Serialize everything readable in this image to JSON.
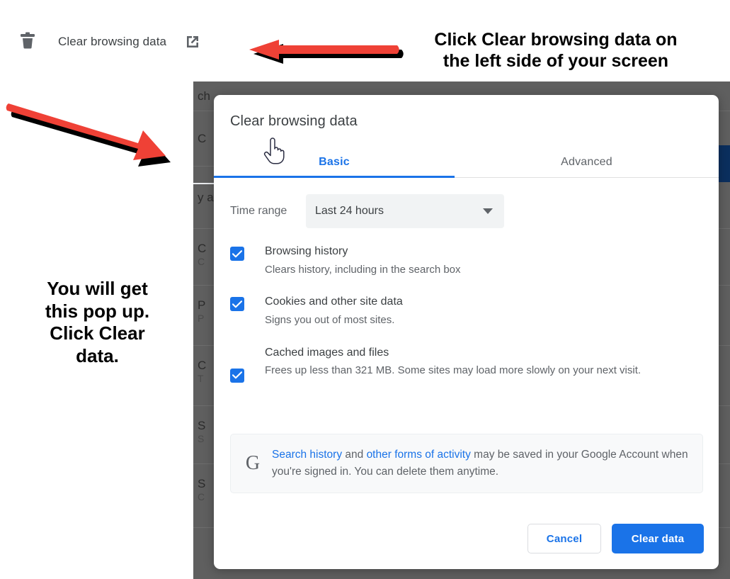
{
  "topbar": {
    "trash_icon": "trash-icon",
    "label": "Clear browsing data",
    "external_icon": "open-in-new-icon"
  },
  "annotations": {
    "top": "Click Clear browsing data on the left side of your screen",
    "top_line1": "Click Clear browsing data on",
    "top_line2": "the left side of your screen",
    "left_line1": "You will get",
    "left_line2": "this pop up.",
    "left_line3": "Click Clear",
    "left_line4": "data.",
    "arrow_color": "#ef4136",
    "arrow_shadow_color": "#000000"
  },
  "background": {
    "rows": [
      {
        "title": "ch",
        "sub": ""
      },
      {
        "title": "C",
        "sub": ""
      },
      {
        "title": "y a",
        "sub": ""
      },
      {
        "title": "C",
        "sub": "C"
      },
      {
        "title": "P",
        "sub": "P"
      },
      {
        "title": "C",
        "sub": "T"
      },
      {
        "title": "S",
        "sub": "S"
      },
      {
        "title": "S",
        "sub": "C"
      }
    ],
    "accent_color": "#0b2f5e",
    "overlay_color": "#5f5f5f"
  },
  "dialog": {
    "title": "Clear browsing data",
    "cursor_icon": "hand-pointer-cursor",
    "tabs": [
      {
        "label": "Basic",
        "active": true
      },
      {
        "label": "Advanced",
        "active": false
      }
    ],
    "time_range": {
      "label": "Time range",
      "value": "Last 24 hours",
      "caret_icon": "chevron-down-icon"
    },
    "options": [
      {
        "checked": true,
        "title": "Browsing history",
        "desc": "Clears history, including in the search box"
      },
      {
        "checked": true,
        "title": "Cookies and other site data",
        "desc": "Signs you out of most sites."
      },
      {
        "checked": true,
        "title": "Cached images and files",
        "desc": "Frees up less than 321 MB. Some sites may load more slowly on your next visit."
      }
    ],
    "google_info": {
      "logo": "G",
      "link1": "Search history",
      "mid": " and ",
      "link2": "other forms of activity",
      "rest": " may be saved in your Google Account when you're signed in. You can delete them anytime."
    },
    "footer": {
      "cancel_label": "Cancel",
      "clear_label": "Clear data"
    },
    "accent_color": "#1a73e8"
  }
}
